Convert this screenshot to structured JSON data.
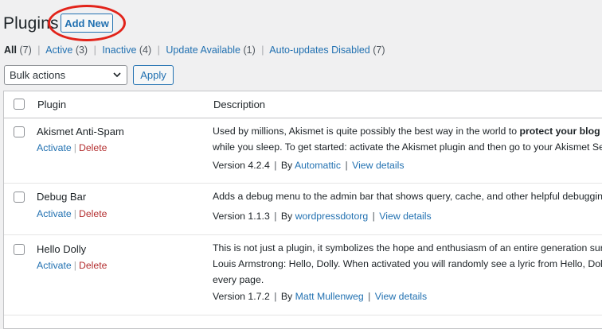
{
  "page": {
    "title": "Plugins",
    "add_new_label": "Add New"
  },
  "filters": [
    {
      "label": "All",
      "count": "(7)",
      "current": true
    },
    {
      "label": "Active",
      "count": "(3)"
    },
    {
      "label": "Inactive",
      "count": "(4)"
    },
    {
      "label": "Update Available",
      "count": "(1)"
    },
    {
      "label": "Auto-updates Disabled",
      "count": "(7)"
    }
  ],
  "bulk": {
    "selected": "Bulk actions",
    "apply_label": "Apply"
  },
  "table": {
    "col_plugin": "Plugin",
    "col_description": "Description",
    "rows": [
      {
        "name": "Akismet Anti-Spam",
        "activate": "Activate",
        "delete": "Delete",
        "desc_line1_pre": "Used by millions, Akismet is quite possibly the best way in the world to ",
        "desc_line1_bold": "protect your blog f",
        "desc_line2": "while you sleep. To get started: activate the Akismet plugin and then go to your Akismet Se",
        "version": "Version 4.2.4",
        "by": "By",
        "author": "Automattic",
        "details": "View details"
      },
      {
        "name": "Debug Bar",
        "activate": "Activate",
        "delete": "Delete",
        "desc_line1": "Adds a debug menu to the admin bar that shows query, cache, and other helpful debuggin",
        "version": "Version 1.1.3",
        "by": "By",
        "author": "wordpressdotorg",
        "details": "View details"
      },
      {
        "name": "Hello Dolly",
        "activate": "Activate",
        "delete": "Delete",
        "desc_line1": "This is not just a plugin, it symbolizes the hope and enthusiasm of an entire generation sur",
        "desc_line2": "Louis Armstrong: Hello, Dolly. When activated you will randomly see a lyric from Hello, Dol",
        "desc_line3": "every page.",
        "version": "Version 1.7.2",
        "by": "By",
        "author": "Matt Mullenweg",
        "details": "View details"
      }
    ]
  },
  "separators": {
    "pipe": "|"
  },
  "colors": {
    "link": "#2271b1",
    "delete": "#b32d2e",
    "annotation": "#e2231a"
  },
  "icons": {
    "bulk_dropdown": "chevron-down-icon"
  }
}
